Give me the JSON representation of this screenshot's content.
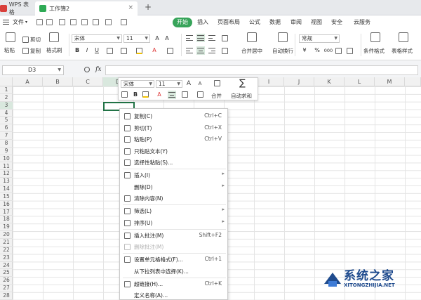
{
  "titlebar": {
    "app_tab": "WPS 表格",
    "doc_tab": "工作簿2",
    "close_glyph": "×",
    "new_tab_glyph": "+"
  },
  "menubar": {
    "file_label": "文件",
    "tabs": [
      "开始",
      "插入",
      "页面布局",
      "公式",
      "数据",
      "审阅",
      "视图",
      "安全",
      "云服务"
    ],
    "active_tab": "开始"
  },
  "ribbon": {
    "cut": "剪切",
    "paste": "粘贴",
    "copy": "复制",
    "format_painter": "格式刷",
    "font_name": "宋体",
    "font_size": "11",
    "bold": "B",
    "italic": "I",
    "underline": "U",
    "grow_font": "A+",
    "shrink_font": "A-",
    "merge_center": "合并居中",
    "wrap_text": "自动换行",
    "number_format": "常规",
    "currency": "¥",
    "percent": "%",
    "thousands": "000",
    "cond_format": "条件格式",
    "table_style": "表格样式"
  },
  "formulabar": {
    "name_box": "D3",
    "fx": "fx",
    "formula": ""
  },
  "grid": {
    "columns": [
      "A",
      "B",
      "C",
      "D",
      "E",
      "F",
      "G",
      "H",
      "I",
      "J",
      "K",
      "L",
      "M"
    ],
    "rows": [
      "1",
      "2",
      "3",
      "4",
      "5",
      "6",
      "7",
      "8",
      "9",
      "10",
      "11",
      "12",
      "13",
      "14",
      "15",
      "16",
      "17",
      "18",
      "19",
      "20",
      "21",
      "22",
      "23",
      "24",
      "25",
      "26",
      "27",
      "28"
    ]
  },
  "mini_toolbar": {
    "font_name": "宋体",
    "font_size": "11",
    "merge": "合并",
    "autosum": "自动求和",
    "bold": "B",
    "grow": "A",
    "shrink": "A",
    "font_color": "A"
  },
  "context_menu": {
    "items": [
      {
        "label": "复制(C)",
        "shortcut": "Ctrl+C",
        "icon": "copy-icon"
      },
      {
        "label": "剪切(T)",
        "shortcut": "Ctrl+X",
        "icon": "scissors-icon"
      },
      {
        "label": "粘贴(P)",
        "shortcut": "Ctrl+V",
        "icon": "paste-icon"
      },
      {
        "label": "只粘贴文本(Y)",
        "shortcut": "",
        "icon": "paste-text-icon"
      },
      {
        "label": "选择性粘贴(S)...",
        "shortcut": "",
        "icon": "paste-special-icon"
      },
      {
        "label": "插入(I)",
        "shortcut": "",
        "icon": "insert-icon",
        "submenu": true
      },
      {
        "label": "删除(D)",
        "shortcut": "",
        "icon": "",
        "submenu": true
      },
      {
        "label": "清除内容(N)",
        "shortcut": "",
        "icon": "clear-icon"
      },
      {
        "label": "筛选(L)",
        "shortcut": "",
        "icon": "filter-icon",
        "submenu": true
      },
      {
        "label": "排序(U)",
        "shortcut": "",
        "icon": "sort-icon",
        "submenu": true
      },
      {
        "label": "插入批注(M)",
        "shortcut": "Shift+F2",
        "icon": "comment-icon"
      },
      {
        "label": "删除批注(M)",
        "shortcut": "",
        "icon": "delete-comment-icon",
        "disabled": true
      },
      {
        "label": "设置单元格格式(F)...",
        "shortcut": "Ctrl+1",
        "icon": "format-cells-icon"
      },
      {
        "label": "从下拉列表中选择(K)...",
        "shortcut": "",
        "icon": ""
      },
      {
        "label": "超链接(H)...",
        "shortcut": "Ctrl+K",
        "icon": "link-icon"
      },
      {
        "label": "定义名称(A)...",
        "shortcut": "",
        "icon": ""
      }
    ]
  },
  "watermark": {
    "title": "系统之家",
    "url": "XITONGZHIJIA.NET"
  },
  "colors": {
    "accent": "#37a45a",
    "selection": "#217346",
    "watermark": "#1f4b8e"
  }
}
